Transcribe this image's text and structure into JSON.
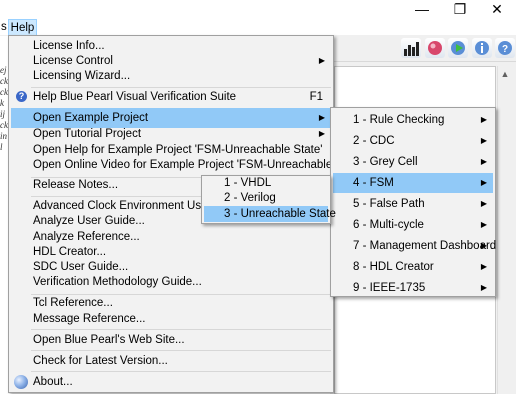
{
  "window": {
    "minimize": "—",
    "restore": "❐",
    "close": "✕"
  },
  "menubar": {
    "left_cut": "s",
    "help": "Help"
  },
  "left_panel_lines": [
    "ej",
    "ck",
    "ck",
    "k",
    "ij",
    "ck",
    "in",
    "l"
  ],
  "help_menu": {
    "license_info": "License Info...",
    "license_control": "License Control",
    "licensing_wizard": "Licensing Wizard...",
    "help_suite": "Help Blue Pearl Visual Verification Suite",
    "help_suite_shortcut": "F1",
    "open_example": "Open Example Project",
    "open_tutorial": "Open Tutorial Project",
    "open_help_example": "Open Help for Example Project 'FSM-Unreachable State'",
    "open_video_example": "Open Online Video for Example Project 'FSM-Unreachable State'",
    "release_notes": "Release Notes...",
    "ace_user_guide": "Advanced Clock Environment User Guide",
    "analyze_user_guide": "Analyze User Guide...",
    "analyze_reference": "Analyze Reference...",
    "hdl_creator": "HDL Creator...",
    "sdc_user_guide": "SDC User Guide...",
    "verification_guide": "Verification Methodology Guide...",
    "tcl_reference": "Tcl Reference...",
    "message_reference": "Message Reference...",
    "website": "Open Blue Pearl's Web Site...",
    "check_version": "Check for Latest Version...",
    "about": "About..."
  },
  "examples_menu": [
    "1 - Rule Checking",
    "2 - CDC",
    "3 - Grey Cell",
    "4 - FSM",
    "5 - False Path",
    "6 - Multi-cycle",
    "7 - Management Dashboard",
    "8 - HDL Creator",
    "9 - IEEE-1735"
  ],
  "fsm_menu": [
    "1 - VHDL",
    "2 - Verilog",
    "3 - Unreachable State"
  ],
  "colors": {
    "highlight": "#91c9f7",
    "menu_bg": "#f2f2f2",
    "menubar_active": "#cce8ff"
  }
}
